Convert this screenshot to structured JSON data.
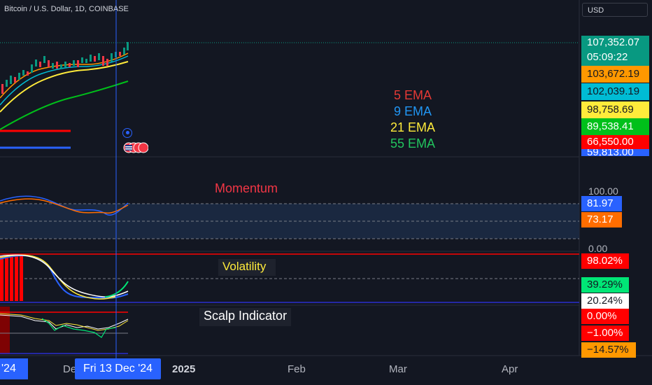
{
  "header": {
    "symbol_title": "Bitcoin / U.S. Dollar, 1D, COINBASE",
    "currency": "USD"
  },
  "price_labels": [
    {
      "name": "last-price",
      "text": "107,352.07",
      "bg": "#089981",
      "fg": "#ffffff"
    },
    {
      "name": "countdown",
      "text": "05:09:22",
      "bg": "#089981",
      "fg": "#ffffff"
    },
    {
      "name": "ema5-value",
      "text": "103,672.19",
      "bg": "#ff9800",
      "fg": "#131722"
    },
    {
      "name": "ema9-value",
      "text": "102,039.19",
      "bg": "#00bcd4",
      "fg": "#131722"
    },
    {
      "name": "ema21-value",
      "text": "98,758.69",
      "bg": "#ffeb3b",
      "fg": "#131722"
    },
    {
      "name": "ema55-value",
      "text": "89,538.41",
      "bg": "#00c01a",
      "fg": "#ffffff"
    },
    {
      "name": "level-red-value",
      "text": "66,550.00",
      "bg": "#ff0000",
      "fg": "#ffffff"
    },
    {
      "name": "level-blue-value",
      "text": "59,813.00",
      "bg": "#2962ff",
      "fg": "#ffffff"
    }
  ],
  "ema_legend": [
    {
      "text": "5 EMA",
      "color": "#e53935"
    },
    {
      "text": "9 EMA",
      "color": "#2196f3"
    },
    {
      "text": "21 EMA",
      "color": "#ffeb3b"
    },
    {
      "text": "55 EMA",
      "color": "#22c55e"
    }
  ],
  "momentum": {
    "title": "Momentum",
    "title_color": "#f23645",
    "axis_top": "100.00",
    "axis_bottom": "0.00",
    "labels": [
      {
        "text": "81.97",
        "bg": "#2962ff",
        "fg": "#ffffff"
      },
      {
        "text": "73.17",
        "bg": "#ff6d00",
        "fg": "#ffffff"
      }
    ]
  },
  "volatility": {
    "title": "Volatility",
    "title_color": "#ffeb3b",
    "labels": [
      {
        "text": "98.02%",
        "bg": "#ff0000",
        "fg": "#ffffff"
      },
      {
        "text": "39.29%",
        "bg": "#00e676",
        "fg": "#131722"
      },
      {
        "text": "20.24%",
        "bg": "#ffffff",
        "fg": "#131722"
      }
    ]
  },
  "scalp": {
    "title": "Scalp Indicator",
    "title_color": "#ffffff",
    "labels": [
      {
        "text": "0.00%",
        "bg": "#ff0000",
        "fg": "#ffffff"
      },
      {
        "text": "−1.00%",
        "bg": "#ff0000",
        "fg": "#ffffff"
      },
      {
        "text": "−14.57%",
        "bg": "#ff9800",
        "fg": "#131722"
      }
    ]
  },
  "time_axis": {
    "left_label": "'24",
    "partial_label": "De",
    "crosshair": "Fri 13 Dec '24",
    "ticks": [
      {
        "text": "2025",
        "bold": true
      },
      {
        "text": "Feb",
        "bold": false
      },
      {
        "text": "Mar",
        "bold": false
      },
      {
        "text": "Apr",
        "bold": false
      }
    ]
  },
  "icons": [
    "target-icon",
    "flag-icon"
  ]
}
